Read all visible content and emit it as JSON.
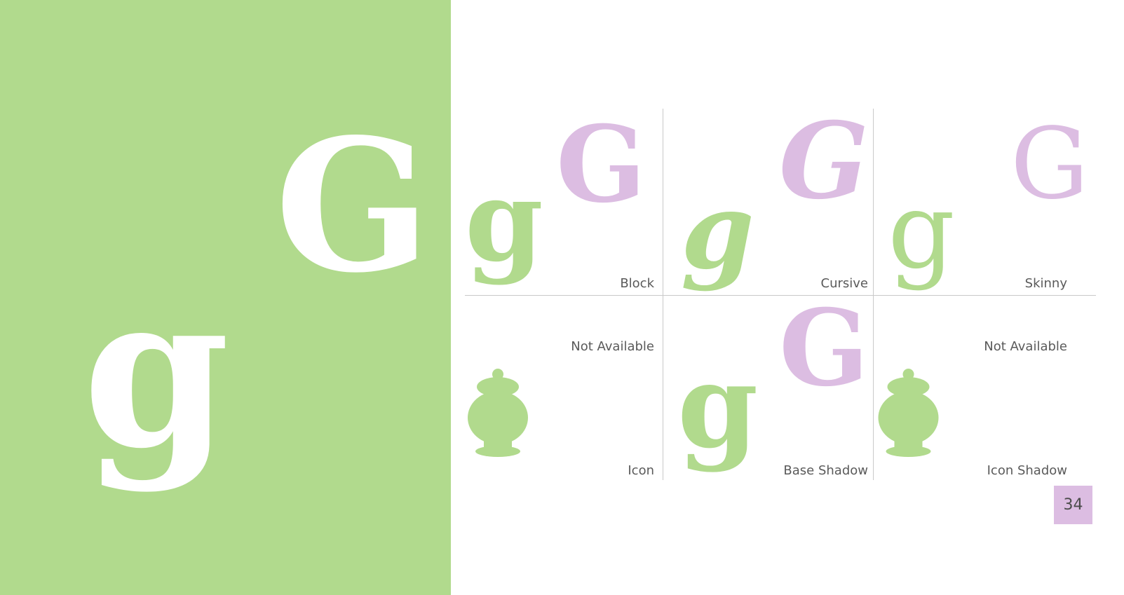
{
  "left": {
    "upper_glyph": "G",
    "lower_glyph": "g"
  },
  "variants": {
    "block": {
      "label": "Block",
      "upper": "G",
      "lower": "g"
    },
    "cursive": {
      "label": "Cursive",
      "upper": "G",
      "lower": "g"
    },
    "skinny": {
      "label": "Skinny",
      "upper": "G",
      "lower": "g"
    },
    "icon": {
      "label": "Icon",
      "status": "Not Available",
      "icon": "jar-icon"
    },
    "base_shadow": {
      "label": "Base Shadow",
      "upper": "G",
      "lower": "g"
    },
    "icon_shadow": {
      "label": "Icon Shadow",
      "status": "Not Available",
      "icon": "jar-icon"
    }
  },
  "page_number": "34",
  "colors": {
    "green": "#b1da8d",
    "pink": "#dcbde2",
    "white": "#ffffff"
  }
}
